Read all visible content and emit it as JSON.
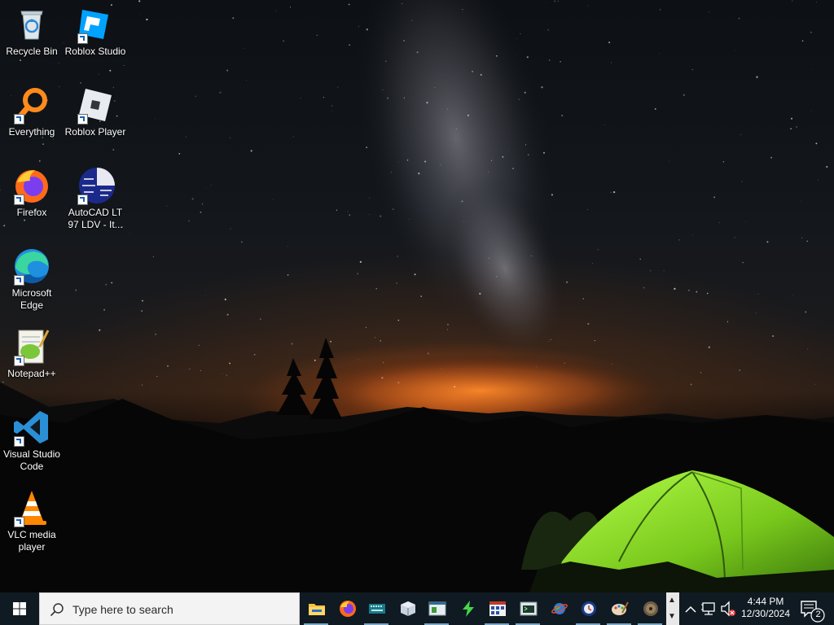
{
  "desktop": {
    "icons": [
      {
        "label": "Recycle Bin",
        "icon": "recycle-bin-icon"
      },
      {
        "label": "Roblox Studio",
        "icon": "roblox-studio-icon"
      },
      {
        "label": "Everything",
        "icon": "everything-search-icon"
      },
      {
        "label": "Roblox Player",
        "icon": "roblox-player-icon"
      },
      {
        "label": "Firefox",
        "icon": "firefox-icon"
      },
      {
        "label": "AutoCAD LT 97 LDV - It...",
        "icon": "autocad-icon"
      },
      {
        "label": "Microsoft Edge",
        "icon": "edge-icon"
      },
      {
        "label": "Notepad++",
        "icon": "notepad-plus-plus-icon"
      },
      {
        "label": "Visual Studio Code",
        "icon": "vscode-icon"
      },
      {
        "label": "VLC media player",
        "icon": "vlc-icon"
      }
    ]
  },
  "taskbar": {
    "search_placeholder": "Type here to search",
    "pinned": [
      "file-explorer-icon",
      "firefox-icon",
      "keyboard-app-icon",
      "package-box-icon",
      "spreadsheet-window-icon",
      "lightning-app-icon",
      "calendar-grid-icon",
      "terminal-window-icon",
      "planet-icon",
      "globe-clock-icon",
      "paint-palette-icon",
      "game-disc-icon"
    ],
    "clock": {
      "time": "4:44 PM",
      "date": "12/30/2024"
    },
    "notification_count": "2"
  },
  "colors": {
    "taskbar": "#101a22",
    "accent": "#7aa7c7",
    "tent": "#8fd42a"
  }
}
